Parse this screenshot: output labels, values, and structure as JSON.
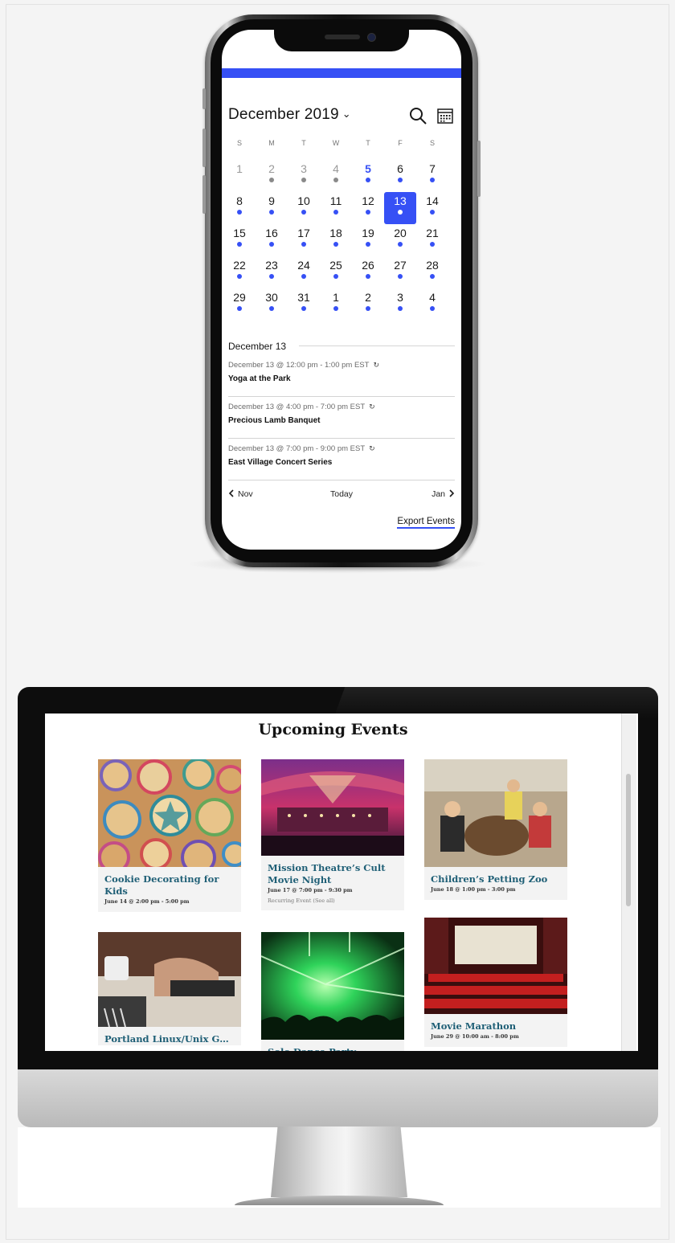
{
  "phone": {
    "month_title": "December 2019",
    "month_caret": "⌄",
    "weekdays": [
      "S",
      "M",
      "T",
      "W",
      "T",
      "F",
      "S"
    ],
    "weeks": [
      [
        "1",
        "2",
        "3",
        "4",
        "5",
        "6",
        "7"
      ],
      [
        "8",
        "9",
        "10",
        "11",
        "12",
        "13",
        "14"
      ],
      [
        "15",
        "16",
        "17",
        "18",
        "19",
        "20",
        "21"
      ],
      [
        "22",
        "23",
        "24",
        "25",
        "26",
        "27",
        "28"
      ],
      [
        "29",
        "30",
        "31",
        "1",
        "2",
        "3",
        "4"
      ]
    ],
    "selected_date_label": "December 13",
    "events": [
      {
        "time": "December 13 @ 12:00 pm - 1:00 pm EST",
        "title": "Yoga at the Park"
      },
      {
        "time": "December 13 @ 4:00 pm - 7:00 pm EST",
        "title": "Precious Lamb Banquet"
      },
      {
        "time": "December 13 @ 7:00 pm - 9:00 pm EST",
        "title": "East Village Concert Series"
      }
    ],
    "nav": {
      "prev": "Nov",
      "today": "Today",
      "next": "Jan"
    },
    "export_label": "Export Events",
    "accent_color": "#3650f5",
    "icons": [
      "search-icon",
      "calendar-grid-icon",
      "repeat-icon",
      "chevron-left-icon",
      "chevron-right-icon"
    ]
  },
  "monitor": {
    "page_title": "Upcoming Events",
    "cards": [
      {
        "title": "Cookie Decorating for Kids",
        "date": "June 14 @ 2:00 pm - 5:00 pm",
        "extra": ""
      },
      {
        "title": "Mission Theatre’s Cult Movie Night",
        "date": "June 17 @ 7:00 pm - 9:30 pm",
        "extra": "Recurring Event (See all)"
      },
      {
        "title": "Children’s Petting Zoo",
        "date": "June 18 @ 1:00 pm - 3:00 pm",
        "extra": ""
      },
      {
        "title": "Portland Linux/Unix G…",
        "date": "",
        "extra": ""
      },
      {
        "title": "Solo Dance Party",
        "date": "",
        "extra": ""
      },
      {
        "title": "Movie Marathon",
        "date": "June 29 @ 10:00 am - 8:00 pm",
        "extra": ""
      }
    ],
    "link_color": "#1f5f76"
  }
}
